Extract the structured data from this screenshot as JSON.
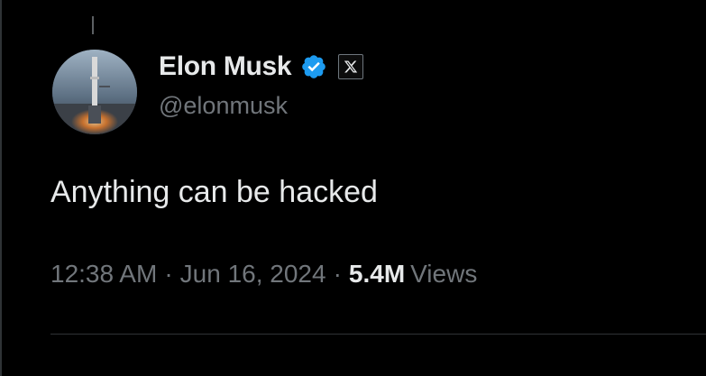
{
  "author": {
    "display_name": "Elon Musk",
    "handle": "@elonmusk",
    "verified": true,
    "verified_color": "#1d9bf0",
    "affiliate_icon": "x-logo-icon"
  },
  "tweet": {
    "text": "Anything can be hacked",
    "time": "12:38 AM",
    "separator": "·",
    "date": "Jun 16, 2024",
    "views_count": "5.4M",
    "views_label": "Views"
  },
  "colors": {
    "background": "#000000",
    "primary_text": "#e7e9ea",
    "secondary_text": "#71767b",
    "divider": "#2f3336"
  }
}
